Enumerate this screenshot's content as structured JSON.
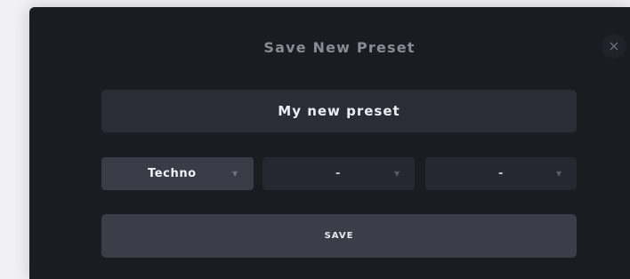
{
  "dialog": {
    "title": "Save New Preset",
    "close_glyph": "×",
    "name_value": "My new preset",
    "selects": [
      {
        "value": "Techno",
        "caret": "▼"
      },
      {
        "value": "-",
        "caret": "▼"
      },
      {
        "value": "-",
        "caret": "▼"
      }
    ],
    "save_label": "SAVE"
  },
  "icons": {
    "close": "close-icon",
    "caret": "caret-down-icon"
  },
  "colors": {
    "dialog_bg": "#1b1b22",
    "field_bg": "#2c2c37",
    "selected_bg": "#3b3b48",
    "button_bg": "#3d3d4a",
    "page_bg": "#f1f1f3"
  }
}
